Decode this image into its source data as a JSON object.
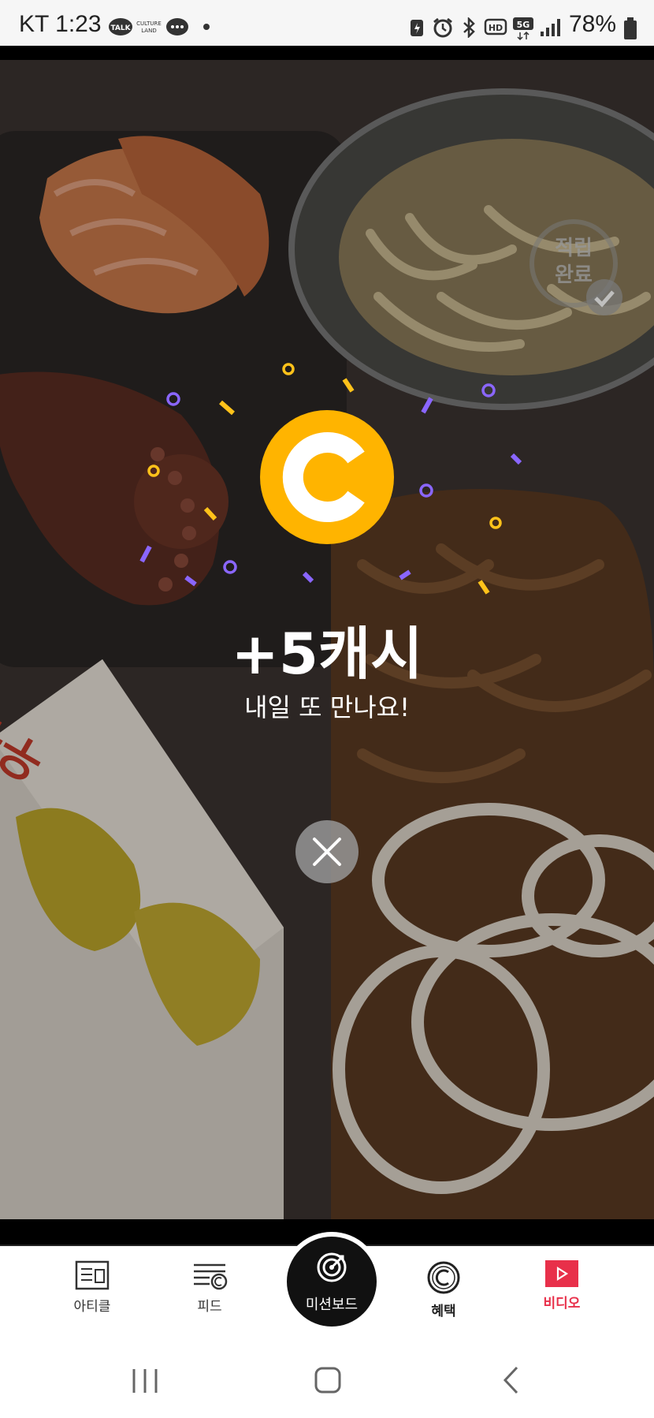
{
  "status_bar": {
    "carrier_time": "KT 1:23",
    "battery": "78%"
  },
  "stamp": {
    "label": "적립\n완료"
  },
  "reward": {
    "amount": "+5캐시",
    "message": "내일 또 만나요!"
  },
  "bottom_nav": {
    "items": [
      {
        "label": "아티클",
        "icon": "article-icon"
      },
      {
        "label": "피드",
        "icon": "feed-icon"
      },
      {
        "label": "미션보드",
        "icon": "mission-target-icon"
      },
      {
        "label": "혜택",
        "icon": "cash-coin-icon"
      },
      {
        "label": "비디오",
        "icon": "video-play-icon",
        "active": true
      }
    ]
  },
  "colors": {
    "coin": "#ffb400",
    "confetti_purple": "#8a66ff",
    "confetti_yellow": "#ffc21a",
    "active_tab": "#e8304a"
  }
}
